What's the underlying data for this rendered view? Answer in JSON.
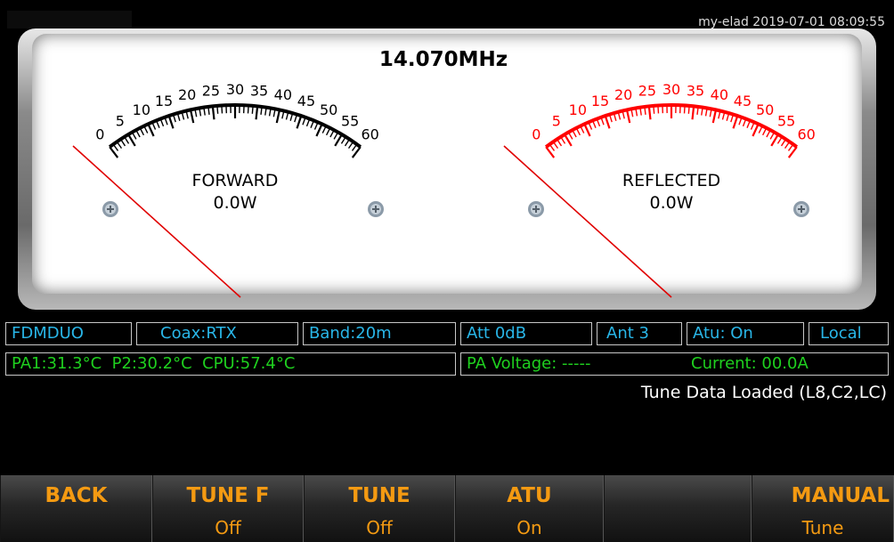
{
  "header": {
    "datetime": "my-elad 2019-07-01 08:09:55"
  },
  "meter": {
    "frequency": "14.070MHz",
    "forward": {
      "title": "FORWARD",
      "value": "0.0W",
      "scale_color": "#000000"
    },
    "reflected": {
      "title": "REFLECTED",
      "value": "0.0W",
      "scale_color": "#ff0000"
    },
    "scale_labels": [
      "0",
      "5",
      "10",
      "15",
      "20",
      "25",
      "30",
      "35",
      "40",
      "45",
      "50",
      "55",
      "60"
    ],
    "needle_color": "#e00000",
    "needle_level": 0
  },
  "status_row1": [
    "FDMDUO",
    "Coax:RTX",
    "Band:20m",
    "Att 0dB",
    "Ant 3",
    "Atu: On",
    "Local"
  ],
  "status_row2": {
    "temps": "PA1:31.3°C  P2:30.2°C  CPU:57.4°C",
    "voltage": "PA Voltage: -----",
    "current": "Current: 00.0A"
  },
  "message": "Tune Data Loaded (L8,C2,LC)",
  "buttons": [
    {
      "label": "BACK",
      "sub": ""
    },
    {
      "label": "TUNE F",
      "sub": "Off"
    },
    {
      "label": "TUNE",
      "sub": "Off"
    },
    {
      "label": "ATU",
      "sub": "On"
    },
    {
      "label": "",
      "sub": ""
    },
    {
      "label": "MANUAL",
      "sub": "Tune"
    }
  ]
}
